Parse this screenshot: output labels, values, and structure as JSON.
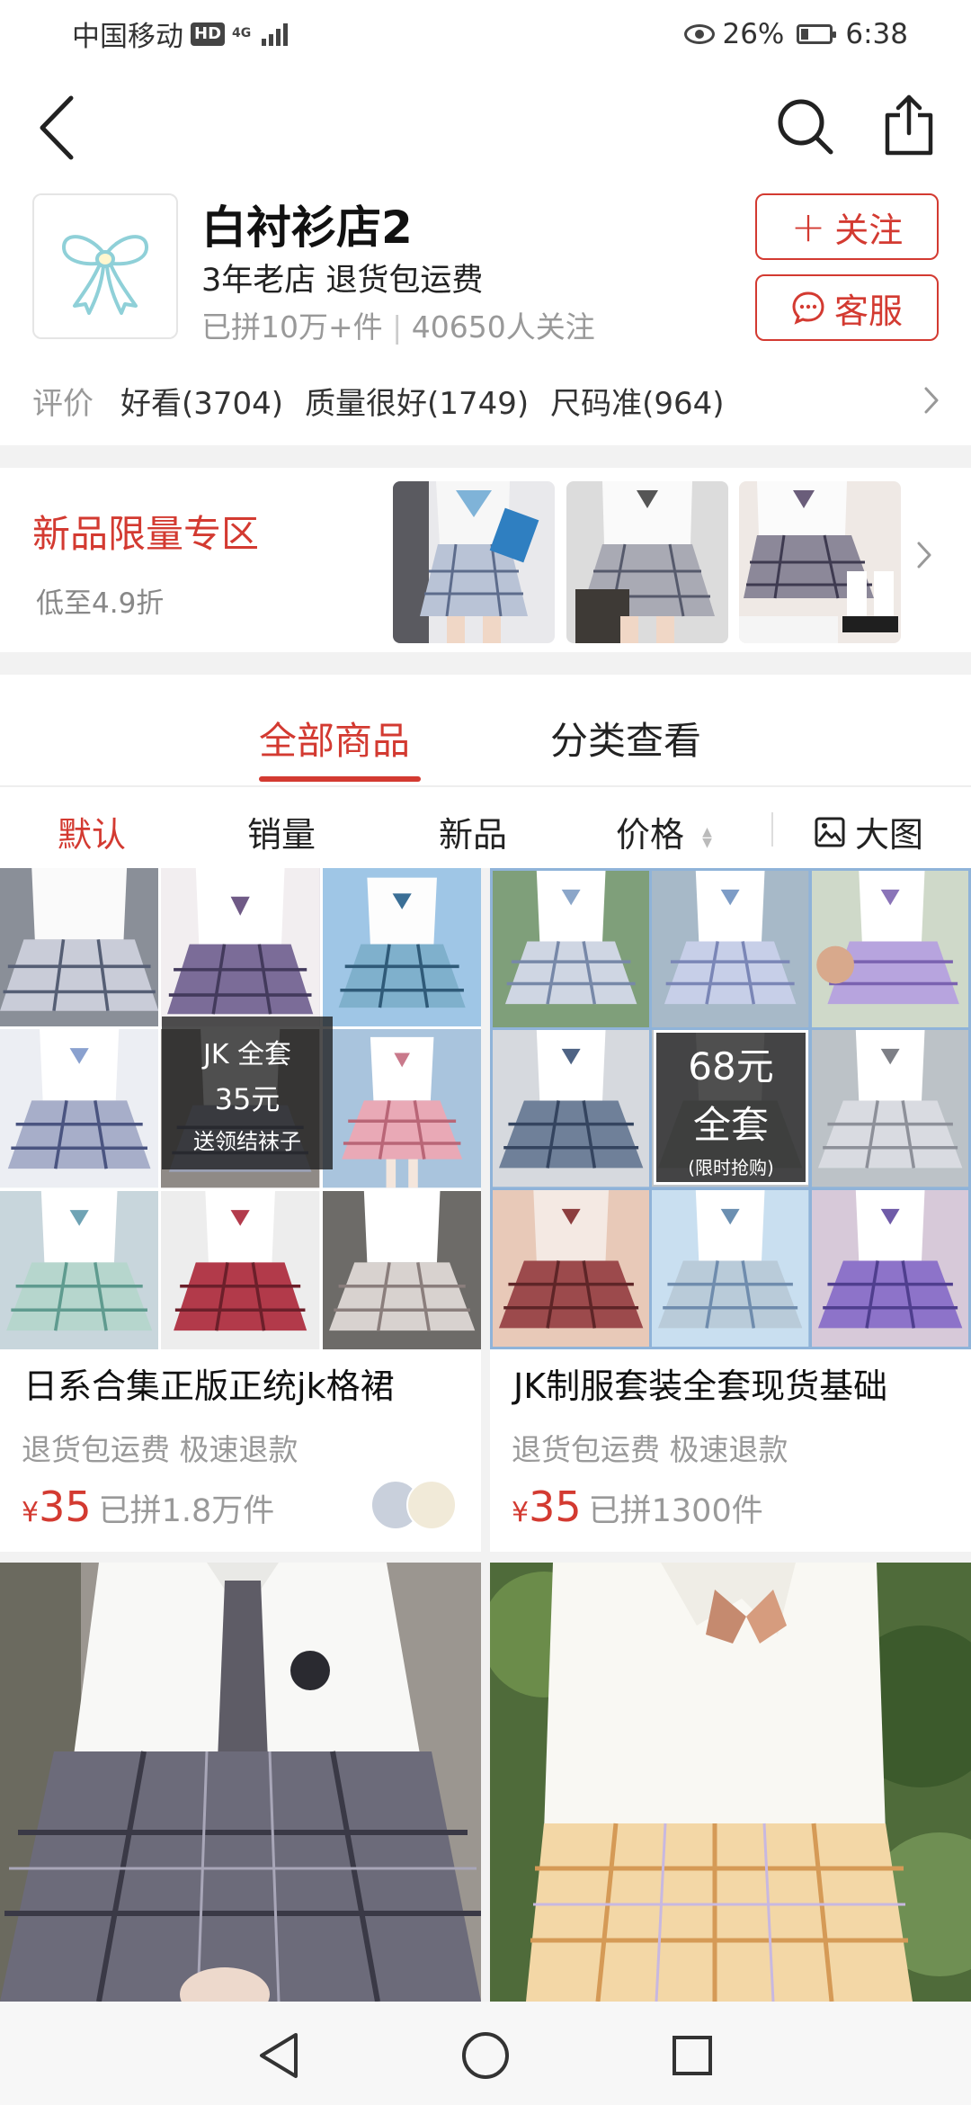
{
  "status_bar": {
    "carrier": "中国移动",
    "hd": "HD",
    "network": "4G",
    "battery": "26%",
    "time": "6:38"
  },
  "shop": {
    "name": "白衬衫店2",
    "tags": "3年老店 退货包运费",
    "stats_sold": "已拼10万+件",
    "stats_followers": "40650人关注",
    "follow_label": "关注",
    "service_label": "客服"
  },
  "reviews": {
    "label": "评价",
    "items": [
      "好看(3704)",
      "质量很好(1749)",
      "尺码准(964)"
    ]
  },
  "promo": {
    "title": "新品限量专区",
    "subtitle": "低至4.9折"
  },
  "tabs": [
    "全部商品",
    "分类查看"
  ],
  "sort": [
    "默认",
    "销量",
    "新品",
    "价格",
    "大图"
  ],
  "products": [
    {
      "title": "日系合集正版正统jk格裙",
      "tags": "退货包运费  极速退款",
      "currency": "¥",
      "price": "35",
      "sold": "已拼1.8万件",
      "overlay_line1": "JK 全套",
      "overlay_line2": "35元",
      "overlay_line3": "送领结袜子"
    },
    {
      "title": "JK制服套装全套现货基础",
      "tags": "退货包运费  极速退款",
      "currency": "¥",
      "price": "35",
      "sold": "已拼1300件",
      "overlay_line1": "68元",
      "overlay_line2": "全套",
      "overlay_line3": "(限时抢购)"
    }
  ],
  "colors": {
    "accent": "#d33a31",
    "muted": "#999999"
  }
}
